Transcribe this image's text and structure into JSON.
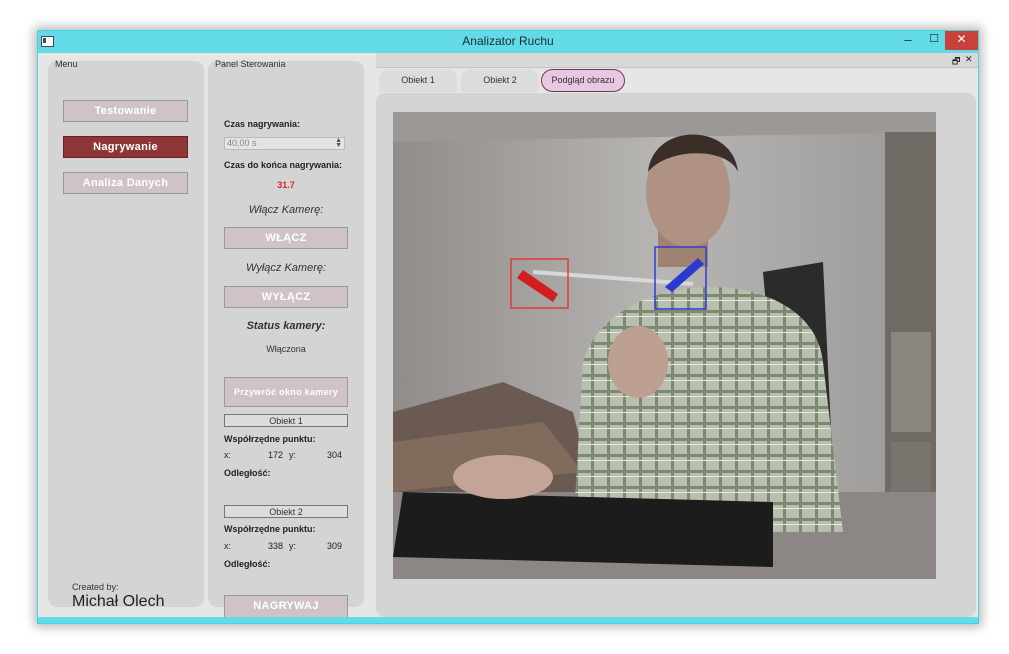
{
  "window": {
    "title": "Analizator Ruchu",
    "min_label": "–",
    "max_label": "☐",
    "close_label": "✕"
  },
  "menu": {
    "title": "Menu",
    "items": [
      {
        "label": "Testowanie",
        "active": false
      },
      {
        "label": "Nagrywanie",
        "active": true
      },
      {
        "label": "Analiza Danych",
        "active": false
      }
    ],
    "created_by": "Created by:",
    "author": "Michał Olech"
  },
  "control": {
    "title": "Panel Sterowania",
    "rec_time_label": "Czas nagrywania:",
    "rec_time_value": "40,00 s",
    "time_left_label": "Czas do końca nagrywania:",
    "time_left_value": "31.7",
    "camera_on_label": "Włącz Kamerę:",
    "camera_on_button": "WŁĄCZ",
    "camera_off_label": "Wyłącz Kamerę:",
    "camera_off_button": "WYŁĄCZ",
    "status_label": "Status kamery:",
    "status_value": "Włączona",
    "restore_button": "Przywróć okno kamery",
    "object1": {
      "title": "Obiekt 1",
      "coords_label": "Współrzędne punktu:",
      "x_label": "x:",
      "x_value": "172",
      "y_label": "y:",
      "y_value": "304",
      "distance_label": "Odległość:"
    },
    "object2": {
      "title": "Obiekt 2",
      "coords_label": "Współrzędne punktu:",
      "x_label": "x:",
      "x_value": "338",
      "y_label": "y:",
      "y_value": "309",
      "distance_label": "Odległość:"
    },
    "record_button": "NAGRYWAJ"
  },
  "main": {
    "restore_icon": "restore-icon",
    "close_icon": "close-icon",
    "tabs": [
      {
        "label": "Obiekt 1",
        "active": false
      },
      {
        "label": "Obiekt 2",
        "active": false
      },
      {
        "label": "Podgląd obrazu",
        "active": true
      }
    ],
    "tracker_colors": {
      "object1": "#e53935",
      "object2": "#2f3bd8"
    }
  }
}
